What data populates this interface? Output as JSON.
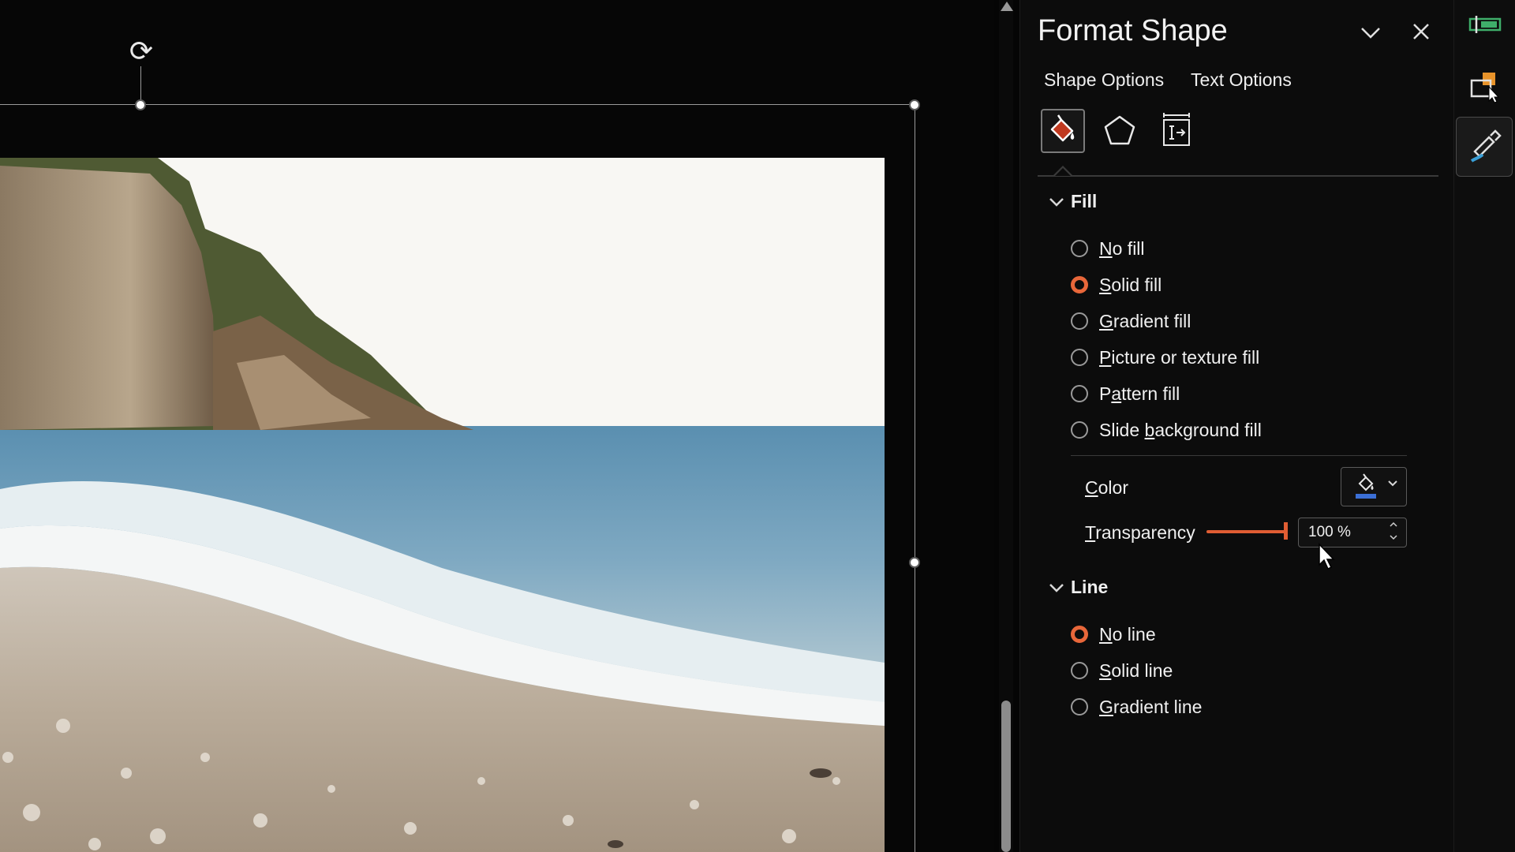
{
  "pane": {
    "title": "Format Shape",
    "tabs": [
      {
        "label": "Shape Options"
      },
      {
        "label": "Text Options"
      }
    ],
    "categories": [
      {
        "icon": "fill-line-icon",
        "active": true
      },
      {
        "icon": "effects-pentagon-icon",
        "active": false
      },
      {
        "icon": "size-properties-icon",
        "active": false
      }
    ],
    "fill": {
      "header": "Fill",
      "options": [
        {
          "label": "No fill",
          "accel": "N",
          "checked": false
        },
        {
          "label": "Solid fill",
          "accel": "S",
          "checked": true
        },
        {
          "label": "Gradient fill",
          "accel": "G",
          "checked": false
        },
        {
          "label": "Picture or texture fill",
          "accel": "P",
          "checked": false
        },
        {
          "label": "Pattern fill",
          "accel": "a",
          "checked": false
        },
        {
          "label": "Slide background fill",
          "accel": "b",
          "checked": false
        }
      ],
      "color_label": "Color",
      "color_value": "#3b6fd6",
      "transparency_label": "Transparency",
      "transparency_value": "100 %",
      "transparency_percent": 100
    },
    "line": {
      "header": "Line",
      "options": [
        {
          "label": "No line",
          "accel": "N",
          "checked": true
        },
        {
          "label": "Solid line",
          "accel": "S",
          "checked": false
        },
        {
          "label": "Gradient line",
          "accel": "G",
          "checked": false
        }
      ]
    }
  },
  "colors": {
    "accent": "#e8673a",
    "pane_bg": "#0c0c0c",
    "canvas_bg": "#060606"
  },
  "toolbar_icons": [
    "layout-icon",
    "shape-select-icon",
    "format-brush-icon"
  ]
}
